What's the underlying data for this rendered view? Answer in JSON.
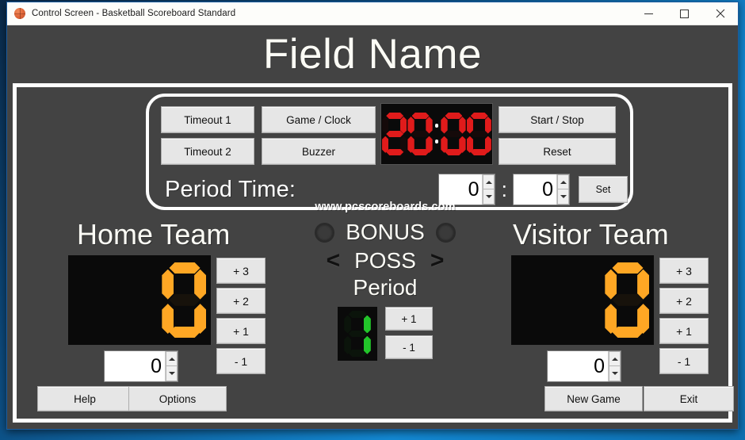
{
  "window": {
    "title": "Control Screen - Basketball Scoreboard Standard",
    "icon": "basketball-icon",
    "minimize_label": "Minimize",
    "maximize_label": "Maximize",
    "close_label": "Close"
  },
  "header": {
    "field_name": "Field Name"
  },
  "clock_panel": {
    "timeout1_label": "Timeout 1",
    "timeout2_label": "Timeout 2",
    "game_clock_label": "Game / Clock",
    "buzzer_label": "Buzzer",
    "start_stop_label": "Start / Stop",
    "reset_label": "Reset",
    "clock_value": "20:00",
    "clock_color": "#e01b1b",
    "period_time_label": "Period Time:",
    "period_minutes_value": "0",
    "period_seconds_value": "0",
    "time_separator": ":",
    "set_label": "Set"
  },
  "home": {
    "title": "Home Team",
    "score": "0",
    "score_color": "#ffa724",
    "adjust_value": "0",
    "buttons": [
      "+ 3",
      "+ 2",
      "+ 1",
      "- 1"
    ]
  },
  "visitor": {
    "title": "Visitor Team",
    "score": "0",
    "score_color": "#ffa724",
    "adjust_value": "0",
    "buttons": [
      "+ 3",
      "+ 2",
      "+ 1",
      "- 1"
    ]
  },
  "center": {
    "website": "www.pcscoreboards.com",
    "bonus_label": "BONUS",
    "bonus_home_state": "off",
    "bonus_visitor_state": "off",
    "poss_label": "POSS",
    "poss_left_arrow": "<",
    "poss_right_arrow": ">",
    "period_label": "Period",
    "period_value": "1",
    "period_color": "#22c52a",
    "period_plus_label": "+ 1",
    "period_minus_label": "- 1"
  },
  "footer": {
    "help_label": "Help",
    "options_label": "Options",
    "new_game_label": "New Game",
    "exit_label": "Exit"
  }
}
